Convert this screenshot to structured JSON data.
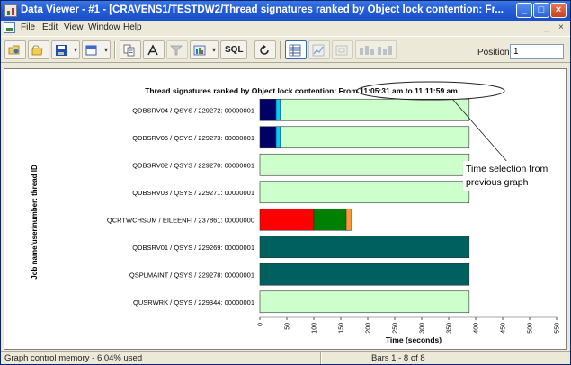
{
  "window": {
    "title": "Data Viewer - #1 - [CRAVENS1/TESTDW2/Thread signatures ranked by Object lock contention: Fr...",
    "min_glyph": "_",
    "max_glyph": "□",
    "close_glyph": "×"
  },
  "menu": {
    "items": [
      "File",
      "Edit",
      "View",
      "Window",
      "Help"
    ],
    "mdi_min": "_",
    "mdi_close": "×"
  },
  "toolbar": {
    "tools": [
      {
        "icon": "open-folder-icon"
      },
      {
        "icon": "open-file-icon"
      },
      {
        "icon": "save-icon"
      },
      {
        "icon": "window-icon"
      },
      {
        "icon": "copy-icon"
      },
      {
        "icon": "font-icon"
      },
      {
        "icon": "filter-icon"
      },
      {
        "icon": "view-icon"
      },
      {
        "icon": "sql-icon",
        "label": "SQL"
      },
      {
        "icon": "refresh-icon"
      },
      {
        "icon": "table-view-icon"
      },
      {
        "icon": "line-graph-icon"
      },
      {
        "icon": "zoom-icon"
      },
      {
        "icon": "bar-graph-icon"
      }
    ],
    "position_label": "Position",
    "position_value": "1"
  },
  "annotation": {
    "callout_text_line1": "Time selection from",
    "callout_text_line2": "previous graph"
  },
  "chart_data": {
    "type": "bar",
    "orientation": "horizontal",
    "stacked": true,
    "title": "Thread signatures ranked by Object lock contention: From 11:05:31 am to 11:11:59 am",
    "xlabel": "Time (seconds)",
    "ylabel": "Job name/user/number: thread ID",
    "xlim": [
      0,
      550
    ],
    "xticks": [
      0,
      50,
      100,
      150,
      200,
      250,
      300,
      350,
      400,
      450,
      500,
      550
    ],
    "categories": [
      "QDBSRV04 / QSYS / 229272: 00000001",
      "QDBSRV05 / QSYS / 229273: 00000001",
      "QDBSRV02 / QSYS / 229270: 00000001",
      "QDBSRV03 / QSYS / 229271: 00000001",
      "QCRTWCHSUM / EILEENFI / 237861: 00000000",
      "QDBSRV01 / QSYS / 229269: 00000001",
      "QSPLMAINT / QSYS / 229278: 00000001",
      "QUSRWRK / QSYS / 229344: 00000001"
    ],
    "series": [
      {
        "color": "#000066",
        "values": [
          30,
          30,
          0,
          0,
          0,
          0,
          0,
          0
        ]
      },
      {
        "color": "#00ccff",
        "values": [
          8,
          8,
          0,
          0,
          0,
          0,
          0,
          0
        ]
      },
      {
        "color": "#ff0000",
        "values": [
          0,
          0,
          0,
          0,
          100,
          0,
          0,
          0
        ]
      },
      {
        "color": "#008000",
        "values": [
          0,
          0,
          0,
          0,
          60,
          0,
          0,
          0
        ]
      },
      {
        "color": "#ff9933",
        "values": [
          0,
          0,
          0,
          0,
          10,
          0,
          0,
          0
        ]
      },
      {
        "color": "#006060",
        "values": [
          0,
          0,
          0,
          0,
          0,
          388,
          388,
          0
        ]
      },
      {
        "color": "#ccffcc",
        "values": [
          350,
          350,
          388,
          388,
          0,
          0,
          0,
          388
        ]
      }
    ]
  },
  "status": {
    "left": "Graph control memory - 6.04% used",
    "right": "Bars 1 - 8 of 8"
  }
}
